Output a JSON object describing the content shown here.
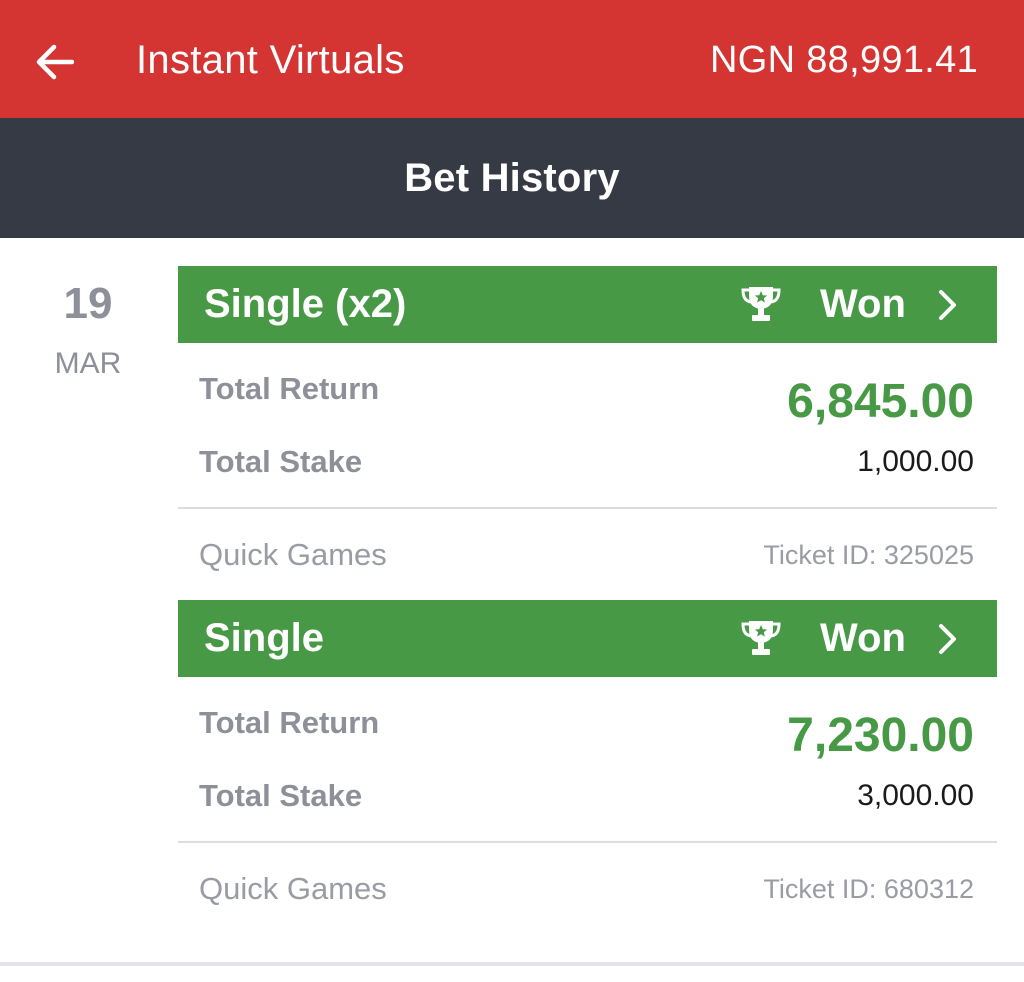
{
  "header": {
    "back_icon": "arrow-left-icon",
    "title": "Instant Virtuals",
    "balance": "NGN 88,991.41",
    "bg_color": "#d43532"
  },
  "page_bar": {
    "title": "Bet History",
    "bg_color": "#363a45"
  },
  "date": {
    "day": "19",
    "month": "MAR"
  },
  "bets": [
    {
      "type": "Single (x2)",
      "status": "Won",
      "status_icon": "trophy-icon",
      "total_return_label": "Total Return",
      "total_return": "6,845.00",
      "total_stake_label": "Total Stake",
      "total_stake": "1,000.00",
      "game": "Quick Games",
      "ticket_id": "Ticket ID: 325025"
    },
    {
      "type": "Single",
      "status": "Won",
      "status_icon": "trophy-icon",
      "total_return_label": "Total Return",
      "total_return": "7,230.00",
      "total_stake_label": "Total Stake",
      "total_stake": "3,000.00",
      "game": "Quick Games",
      "ticket_id": "Ticket ID: 680312"
    }
  ],
  "colors": {
    "won_green": "#479946",
    "muted_gray": "#8d8f99"
  }
}
